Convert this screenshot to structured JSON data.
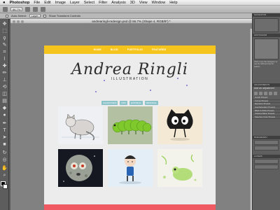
{
  "menubar": {
    "apple": "",
    "app": "Photoshop",
    "items": [
      "File",
      "Edit",
      "Image",
      "Layer",
      "Select",
      "Filter",
      "Analysis",
      "3D",
      "View",
      "Window",
      "Help"
    ]
  },
  "options": {
    "auto_select_label": "Auto-Select:",
    "auto_select_value": "Layer",
    "show_transform": "Show Transform Controls",
    "zoom": "66.7%"
  },
  "document": {
    "title": "andrearingli-redesign.psd @ 66.7% (Shape 4, RGB/8*) *"
  },
  "page": {
    "nav": [
      "HOME",
      "BLOG",
      "PORTFOLIO",
      "FEATURED"
    ],
    "logo_name": "Andrea Ringli",
    "logo_sub": "ILLUSTRATION",
    "filters": [
      "CHARACTERS",
      "KIDS",
      "EDITORIAL",
      "PERSONAL"
    ],
    "colors": {
      "nav": "#f5c51d",
      "footer": "#f05a63",
      "filter": "#8bc3c8"
    }
  },
  "panels": {
    "navigator": "NAVIGATOR",
    "histogram": "HISTOGRAM",
    "history_text": "Click to see the Histogram or use the Shift and Opt for options",
    "adjustments": "ADJUSTMENTS",
    "styles": "STYLES",
    "add_adjustment": "Add an adjustment",
    "presets": [
      "Levels Presets",
      "Curves Presets",
      "Exposure Presets",
      "Hue/Saturation Presets",
      "Black & White Presets",
      "Channel Mixer Presets",
      "Selective Color Presets"
    ],
    "paragraph": "PARAGRAPH",
    "layers": "LAYERS"
  }
}
